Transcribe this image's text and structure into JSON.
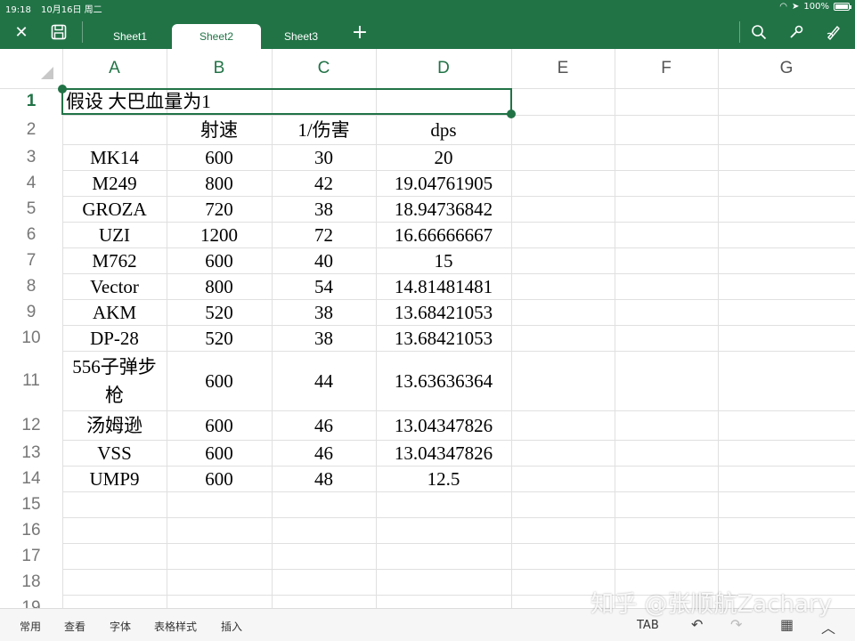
{
  "status": {
    "time": "19:18",
    "date": "10月16日 周二",
    "battery": "100%"
  },
  "toolbar": {
    "close_icon": "close-icon",
    "save_icon": "save-icon",
    "tabs": [
      "Sheet1",
      "Sheet2",
      "Sheet3"
    ],
    "active_tab": "Sheet2",
    "add_icon": "plus-icon",
    "search_icon": "search-icon",
    "tools_icon": "wrench-icon",
    "draw_icon": "draw-icon"
  },
  "columns": [
    "A",
    "B",
    "C",
    "D",
    "E",
    "F",
    "G"
  ],
  "rows": [
    "1",
    "2",
    "3",
    "4",
    "5",
    "6",
    "7",
    "8",
    "9",
    "10",
    "11",
    "12",
    "13",
    "14",
    "15",
    "16",
    "17",
    "18",
    "19"
  ],
  "sheet": {
    "title": "假设 大巴血量为1",
    "headers": [
      "",
      "射速",
      "1/伤害",
      "dps"
    ],
    "data": [
      [
        "MK14",
        "600",
        "30",
        "20"
      ],
      [
        "M249",
        "800",
        "42",
        "19.04761905"
      ],
      [
        "GROZA",
        "720",
        "38",
        "18.94736842"
      ],
      [
        "UZI",
        "1200",
        "72",
        "16.66666667"
      ],
      [
        "M762",
        "600",
        "40",
        "15"
      ],
      [
        "Vector",
        "800",
        "54",
        "14.81481481"
      ],
      [
        "AKM",
        "520",
        "38",
        "13.68421053"
      ],
      [
        "DP-28",
        "520",
        "38",
        "13.68421053"
      ],
      [
        "556子弹步枪",
        "600",
        "44",
        "13.63636364"
      ],
      [
        "汤姆逊",
        "600",
        "46",
        "13.04347826"
      ],
      [
        "VSS",
        "600",
        "46",
        "13.04347826"
      ],
      [
        "UMP9",
        "600",
        "48",
        "12.5"
      ]
    ]
  },
  "bottom": {
    "menus": [
      "常用",
      "查看",
      "字体",
      "表格样式",
      "插入"
    ],
    "tab_key": "TAB"
  },
  "watermark": "知乎 @张顺航Zachary"
}
